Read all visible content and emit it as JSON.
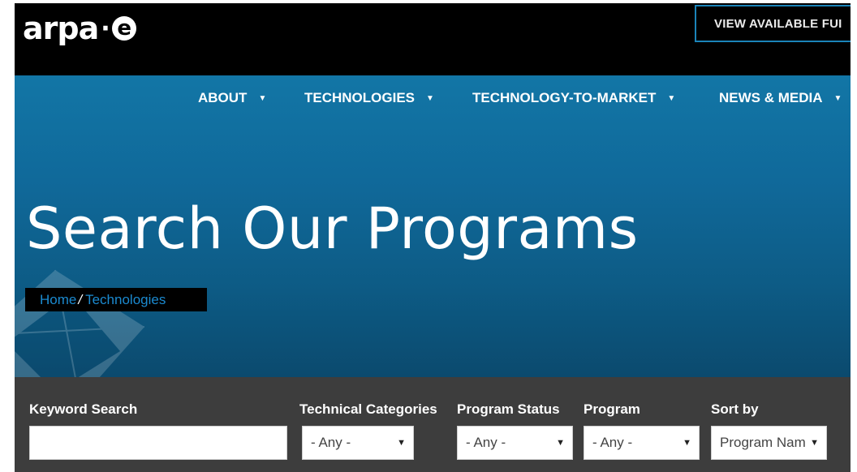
{
  "header": {
    "logo": {
      "text_main": "arpa",
      "text_dot": "·",
      "text_e": "e"
    },
    "funding_button": "VIEW AVAILABLE FUI"
  },
  "nav": {
    "items": [
      {
        "label": "ABOUT",
        "icon": "chevron-down-icon"
      },
      {
        "label": "TECHNOLOGIES",
        "icon": "chevron-down-icon"
      },
      {
        "label": "TECHNOLOGY-TO-MARKET",
        "icon": "chevron-down-icon"
      },
      {
        "label": "NEWS & MEDIA",
        "icon": "chevron-down-icon"
      }
    ],
    "caret_glyph": "▼"
  },
  "hero": {
    "title": "Search Our Programs",
    "breadcrumb": {
      "home": "Home",
      "separator": "/",
      "current": "Technologies"
    }
  },
  "filters": {
    "keyword": {
      "label": "Keyword Search",
      "value": "",
      "placeholder": ""
    },
    "technical_categories": {
      "label": "Technical Categories",
      "selected": "- Any -"
    },
    "program_status": {
      "label": "Program Status",
      "selected": "- Any -"
    },
    "program": {
      "label": "Program",
      "selected": "- Any -"
    },
    "sort_by": {
      "label": "Sort by",
      "selected": "Program Nam"
    },
    "arrow_glyph": "▼"
  },
  "colors": {
    "topbar": "#000000",
    "hero_top": "#1276a6",
    "hero_bottom": "#0b4a6e",
    "filter_bar": "#3d3d3d",
    "link_blue": "#1b8ad0",
    "button_border": "#1b84b9"
  }
}
